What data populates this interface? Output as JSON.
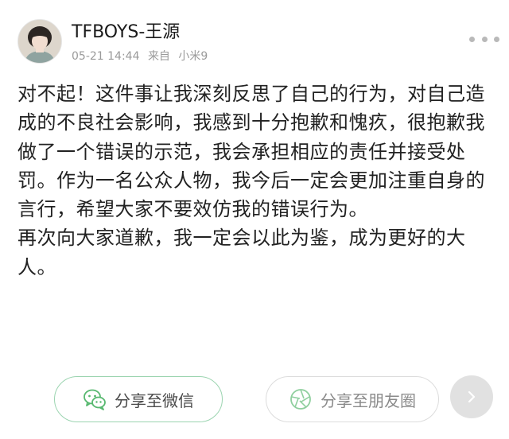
{
  "post": {
    "author": "TFBOYS-王源",
    "date": "05-21 14:44",
    "source_prefix": "来自",
    "source_device": "小米9",
    "paragraphs": [
      "对不起！这件事让我深刻反思了自己的行为，对自己造成的不良社会影响，我感到十分抱歉和愧疚，很抱歉我做了一个错误的示范，我会承担相应的责任并接受处罚。作为一名公众人物，我今后一定会更加注重自身的言行，希望大家不要效仿我的错误行为。",
      "再次向大家道歉，我一定会以此为鉴，成为更好的大人。"
    ]
  },
  "share": {
    "wechat_label": "分享至微信",
    "moments_label": "分享至朋友圈"
  },
  "icons": {
    "more": "more-dots-icon",
    "wechat": "wechat-icon",
    "moments": "moments-shutter-icon",
    "next": "chevron-right-icon"
  },
  "colors": {
    "wechat_accent": "#57b86f",
    "muted_text": "#9a9a9a"
  }
}
